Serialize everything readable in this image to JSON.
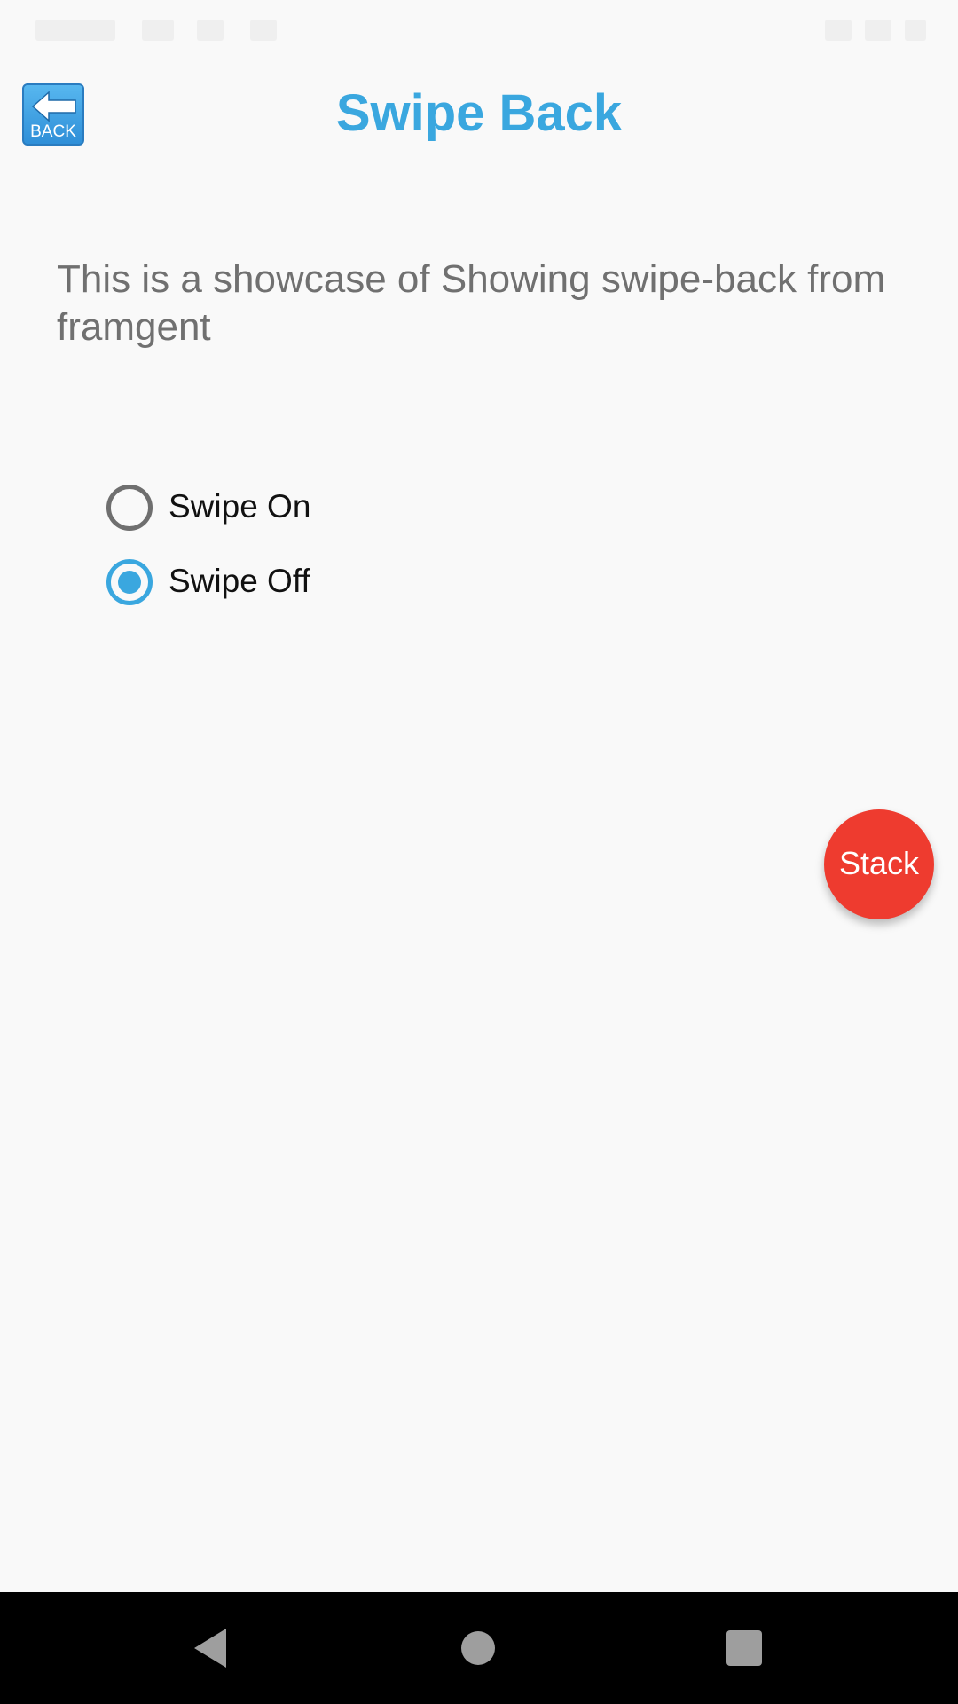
{
  "header": {
    "title": "Swipe Back",
    "back_button_label": "BACK"
  },
  "main": {
    "description": "This is a showcase of Showing swipe-back from framgent",
    "radio_options": [
      {
        "label": "Swipe On",
        "checked": false
      },
      {
        "label": "Swipe Off",
        "checked": true
      }
    ]
  },
  "fab": {
    "label": "Stack"
  },
  "nav_bar": {
    "icons": [
      "back-triangle-icon",
      "home-circle-icon",
      "recents-square-icon"
    ]
  },
  "colors": {
    "accent": "#3aa7df",
    "fab": "#ee3b2f",
    "text_secondary": "#707070",
    "nav_bar": "#000000",
    "background": "#f9f9f9"
  }
}
